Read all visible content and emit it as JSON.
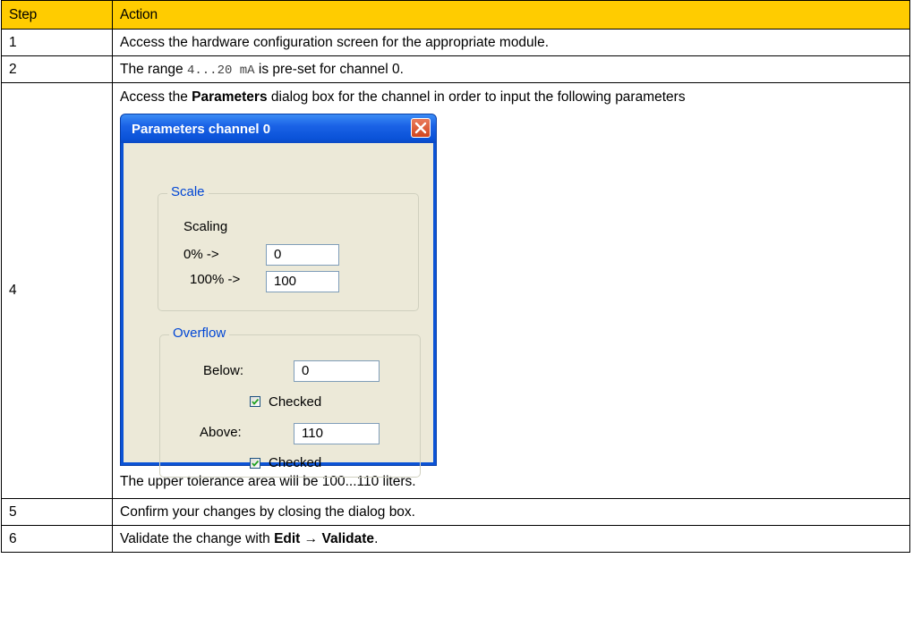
{
  "table": {
    "headers": {
      "step": "Step",
      "action": "Action"
    },
    "rows": {
      "r1": {
        "step": "1",
        "text": "Access the hardware configuration screen for the appropriate module."
      },
      "r2": {
        "step": "2",
        "pre": "The range ",
        "code": "4...20 mA",
        "post": " is pre-set for channel 0."
      },
      "r4": {
        "step": "4",
        "pre": "Access the ",
        "bold": "Parameters",
        "post": " dialog box for the channel in order to input the following parameters",
        "note": "The upper tolerance area will be 100...110 liters."
      },
      "r5": {
        "step": "5",
        "text": "Confirm your changes by closing the dialog box."
      },
      "r6": {
        "step": "6",
        "pre": "Validate the change with ",
        "edit": "Edit",
        "arrow": " → ",
        "validate": "Validate",
        "post": "."
      }
    }
  },
  "dialog": {
    "title": "Parameters channel 0",
    "scale": {
      "group_label": "Scale",
      "scaling_label": "Scaling",
      "zero_label": "0% ->",
      "zero_value": "0",
      "hundred_label": "100% ->",
      "hundred_value": "100"
    },
    "overflow": {
      "group_label": "Overflow",
      "below_label": "Below:",
      "below_value": "0",
      "below_checked_label": "Checked",
      "above_label": "Above:",
      "above_value": "110",
      "above_checked_label": "Checked"
    }
  },
  "colors": {
    "header_bg": "#ffcc00",
    "dialog_title": "#0a52d8",
    "group_label": "#0046d5",
    "close_button": "#d2451d"
  }
}
